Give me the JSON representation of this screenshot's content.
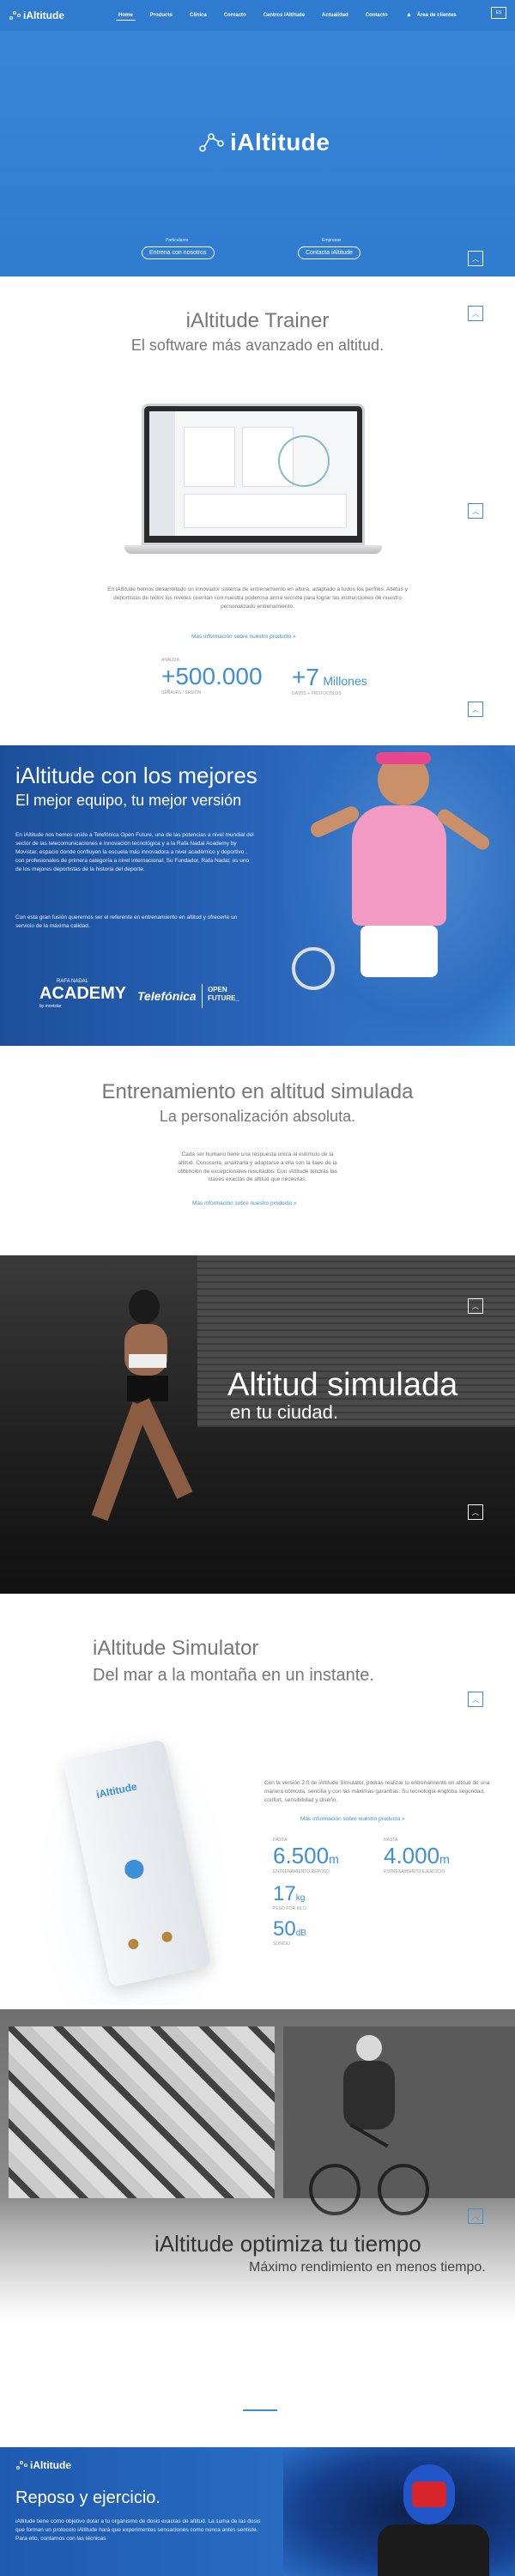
{
  "nav": {
    "logo": "iAltitude",
    "items": [
      "Home",
      "Producto",
      "Clínica",
      "Contacto",
      "Centros iAltitude",
      "Actualidad",
      "Contacto",
      "Área de clientes"
    ],
    "lang": "ES"
  },
  "hero": {
    "logo": "iAltitude",
    "left_caption": "Particulares",
    "left_button": "Entrena con nosotros",
    "right_caption": "Empresas",
    "right_button": "Contacta iAltitude"
  },
  "trainer": {
    "title": "iAltitude Trainer",
    "subtitle": "El software más avanzado en altitud.",
    "paragraph": "En iAltitude hemos desarrollado un innovador sistema de entrenamiento en altura, adaptado a todos los perfiles. Atletas y deportistas de todos los niveles cuentan con nuestra poderosa arma secreta para lograr las instrucciones de nuestro personalizado entrenamiento.",
    "link": "Más información sobre nuestro producto »",
    "stat1_label": "ANALIZA",
    "stat1_value": "+500.000",
    "stat1_sub": "SEÑALES / SESIÓN",
    "stat2_value": "+7",
    "stat2_unit": "Millones",
    "stat2_sub": "DATOS + PROTOCOLOS"
  },
  "mejores": {
    "title": "iAltitude con los mejores",
    "subtitle": "El mejor equipo, tu mejor versión",
    "p1": "En iAltitude nos hemos unido a Telefónica Open Future, una de las potencias a nivel mundial del sector de las telecomunicaciones e innovación tecnológica y a la Rafa Nadal Academy by Movistar, espacio donde confluyen la escuela más innovadora a nivel académico y deportivo , con profesionales de primera categoría a nivel internacional. Su Fundador, Rafa Nadal, es uno de los mejores deportistas de la historia del deporte.",
    "p2": "Con esta gran fusión queremos ser el referente en entrenamiento en altitud y ofrecerte un servicio de la máxima calidad.",
    "logo_rafa_top": "RAFA NADAL",
    "logo_rafa": "ACADEMY",
    "logo_rafa_by": "by movistar",
    "logo_tel": "Telefónica",
    "logo_open": "OPEN FUTURE_"
  },
  "simulada": {
    "title": "Entrenamiento en altitud simulada",
    "subtitle": "La personalización absoluta.",
    "paragraph": "Cada ser humano tiene una respuesta única al estímulo de la altitud. Conocerla, analizarla y adaptarse a ella son la llave de la obtención de excepcionales resultados. Con iAltitude tendrás las claves exactas de altitud que necesitas.",
    "link": "Más información sobre nuestro producto »"
  },
  "running": {
    "title": "Altitud simulada",
    "subtitle": "en tu ciudad."
  },
  "simulator": {
    "title": "iAltitude Simulator",
    "subtitle": "Del mar a la montaña en un instante.",
    "paragraph": "Con la versión 2.0 de iAltitude Simulator, podrás realizar tu entrenamiento en altitud de una manera cómoda, sencilla y con las máximas garantías. Su tecnología engloba seguridad, confort, sensibilidad y diseño.",
    "link": "Más información sobre nuestro producto »",
    "device_label": "iAltitude",
    "s1_label": "HASTA",
    "s1_value": "6.500",
    "s1_unit": "m",
    "s1_sub": "ENTRENAMIENTO REPOSO",
    "s2_label": "HASTA",
    "s2_value": "4.000",
    "s2_unit": "m",
    "s2_sub": "ENTRENAMIENTO EJERCICIO",
    "s3_value": "17",
    "s3_unit": "kg",
    "s3_sub": "PESO POR KILO",
    "s4_value": "50",
    "s4_unit": "dB",
    "s4_sub": "SONIDO"
  },
  "optimiza": {
    "title": "iAltitude optimiza tu tiempo",
    "subtitle": "Máximo rendimiento en menos tiempo."
  },
  "footer": {
    "logo": "iAltitude",
    "title": "Reposo y ejercicio.",
    "paragraph": "iAltitude tiene como objetivo dotar a tu organismo de dosis exactas de altitud. La suma de las dosis que forman un protocolo iAltitude hará que experimentes sensaciones como nunca antes sentiste. Para ello, contamos con las técnicas"
  }
}
